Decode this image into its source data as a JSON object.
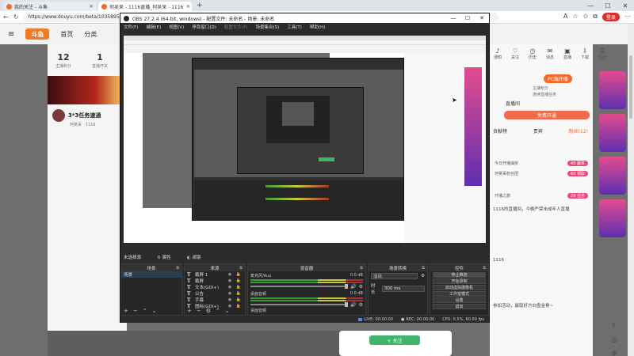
{
  "browser": {
    "tabs": [
      {
        "label": "我的关注 - 斗鱼",
        "active": false
      },
      {
        "label": "何吴呆 - 1116直播_何吴呆 - 1116",
        "active": true
      }
    ],
    "url": "https://www.douyu.com/beta/10358956",
    "login_label": "登录"
  },
  "douyu": {
    "logo": "斗鱼",
    "nav": [
      "首页",
      "分类"
    ],
    "stats": [
      {
        "value": "12",
        "label": "主播积分"
      },
      {
        "value": "1",
        "label": "直播开关"
      }
    ],
    "room_title": "3*3任务速通",
    "room_sub": "何吴呆 · 1116",
    "follow_label": "+ 关注",
    "right_icons": [
      "通知",
      "关注",
      "历史",
      "消息",
      "直播",
      "下载",
      "任务"
    ],
    "pc_live_label": "PC端开播",
    "right_lines": [
      "主播积分",
      "连续直播任务"
    ],
    "anchor_name": "直播间",
    "big_button": "免费开通",
    "right_tabs": [
      "贡献榜",
      "贵宾",
      "粉丝(12)"
    ],
    "rank_rows": [
      {
        "text": "今日开播抽奖",
        "pill": "40 赢奖"
      },
      {
        "text": "何吴呆粉丝团",
        "pill": "60 领取"
      },
      {
        "text": "开播之旅",
        "pill": "29 任务"
      }
    ],
    "chat_lines": [
      "1116的直播间，今晚严禁未成年人直播",
      "1116",
      "参加活动，赢取好方向盘金骨~"
    ]
  },
  "obs": {
    "title": "OBS 27.2.4 (64-bit, windows) - 配置文件: 未命名 - 场景: 未命名",
    "menu": [
      "文件(F)",
      "编辑(E)",
      "视图(V)",
      "停靠窗口(D)",
      "配置文件(P)",
      "场景集合(S)",
      "工具(T)",
      "帮助(H)"
    ],
    "no_source": "未选择源",
    "dock_tabs": [
      "属性",
      "滤镜"
    ],
    "scenes": {
      "title": "场景",
      "items": [
        "场景"
      ]
    },
    "sources": {
      "title": "来源",
      "items": [
        "截屏 1",
        "截屏",
        "文本(GDI+)",
        "公告",
        "字幕",
        "图标(GDI+)"
      ]
    },
    "mixer": {
      "title": "混音器",
      "channels": [
        {
          "name": "麦克风/Aux",
          "db": "0.0 dB"
        },
        {
          "name": "桌面音频",
          "db": "0.0 dB"
        }
      ],
      "footer": "桌面音频"
    },
    "transitions": {
      "title": "场景转换",
      "type": "淡出",
      "duration_label": "时长",
      "duration": "300 ms"
    },
    "controls": {
      "title": "控件",
      "buttons": [
        "停止推流",
        "开始录制",
        "启动虚拟摄像机",
        "工作室模式",
        "设置",
        "退出"
      ]
    },
    "status": {
      "live": "LIVE: 00:00:00",
      "rec": "REC: 00:00:00",
      "cpu": "CPU: 0.5%, 60.00 fps"
    }
  }
}
